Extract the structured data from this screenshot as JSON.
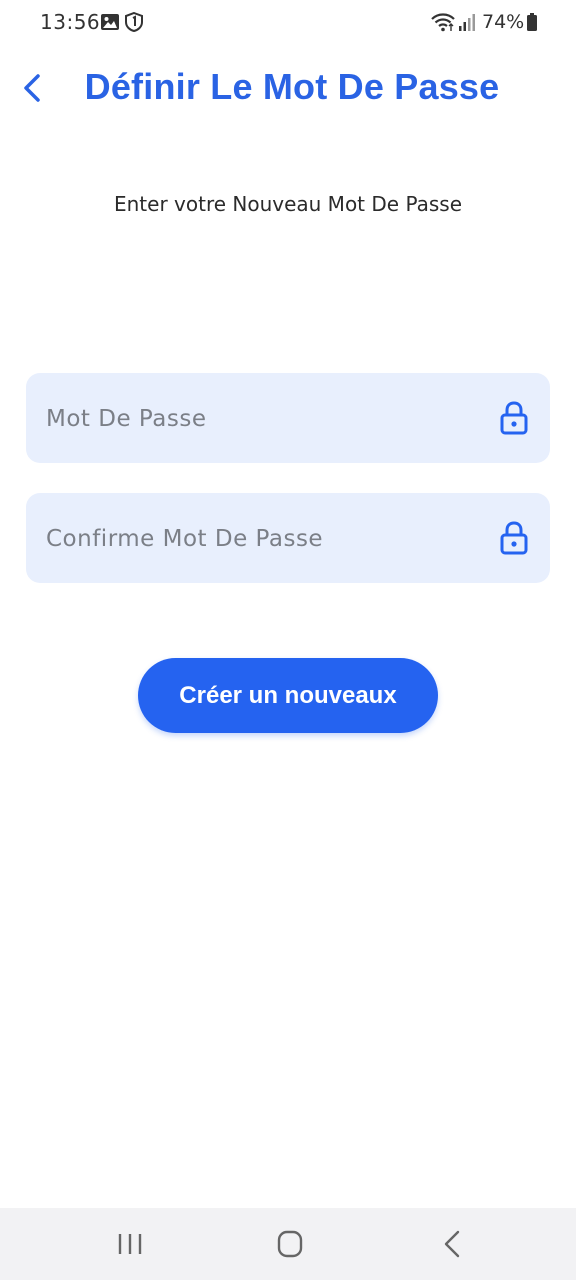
{
  "status_bar": {
    "time": "13:56",
    "battery": "74%",
    "icons": [
      "gallery-icon",
      "shield-one-icon",
      "wifi-icon",
      "signal-icon",
      "battery-icon"
    ]
  },
  "header": {
    "title": "Définir Le Mot De Passe",
    "back_icon": "chevron-left-icon"
  },
  "subtitle": "Enter votre Nouveau Mot De Passe",
  "form": {
    "password": {
      "placeholder": "Mot De Passe",
      "value": "",
      "icon": "lock-icon"
    },
    "confirm_password": {
      "placeholder": "Confirme Mot De Passe",
      "value": "",
      "icon": "lock-icon"
    },
    "submit_label": "Créer un nouveaux"
  },
  "nav_bar": {
    "items": [
      "recent-apps-icon",
      "home-icon",
      "back-icon"
    ]
  },
  "colors": {
    "accent": "#2563f0",
    "title": "#2a63e4",
    "field_bg": "#e8effd",
    "placeholder": "#7b7f87",
    "navbar_bg": "#f2f2f4"
  }
}
